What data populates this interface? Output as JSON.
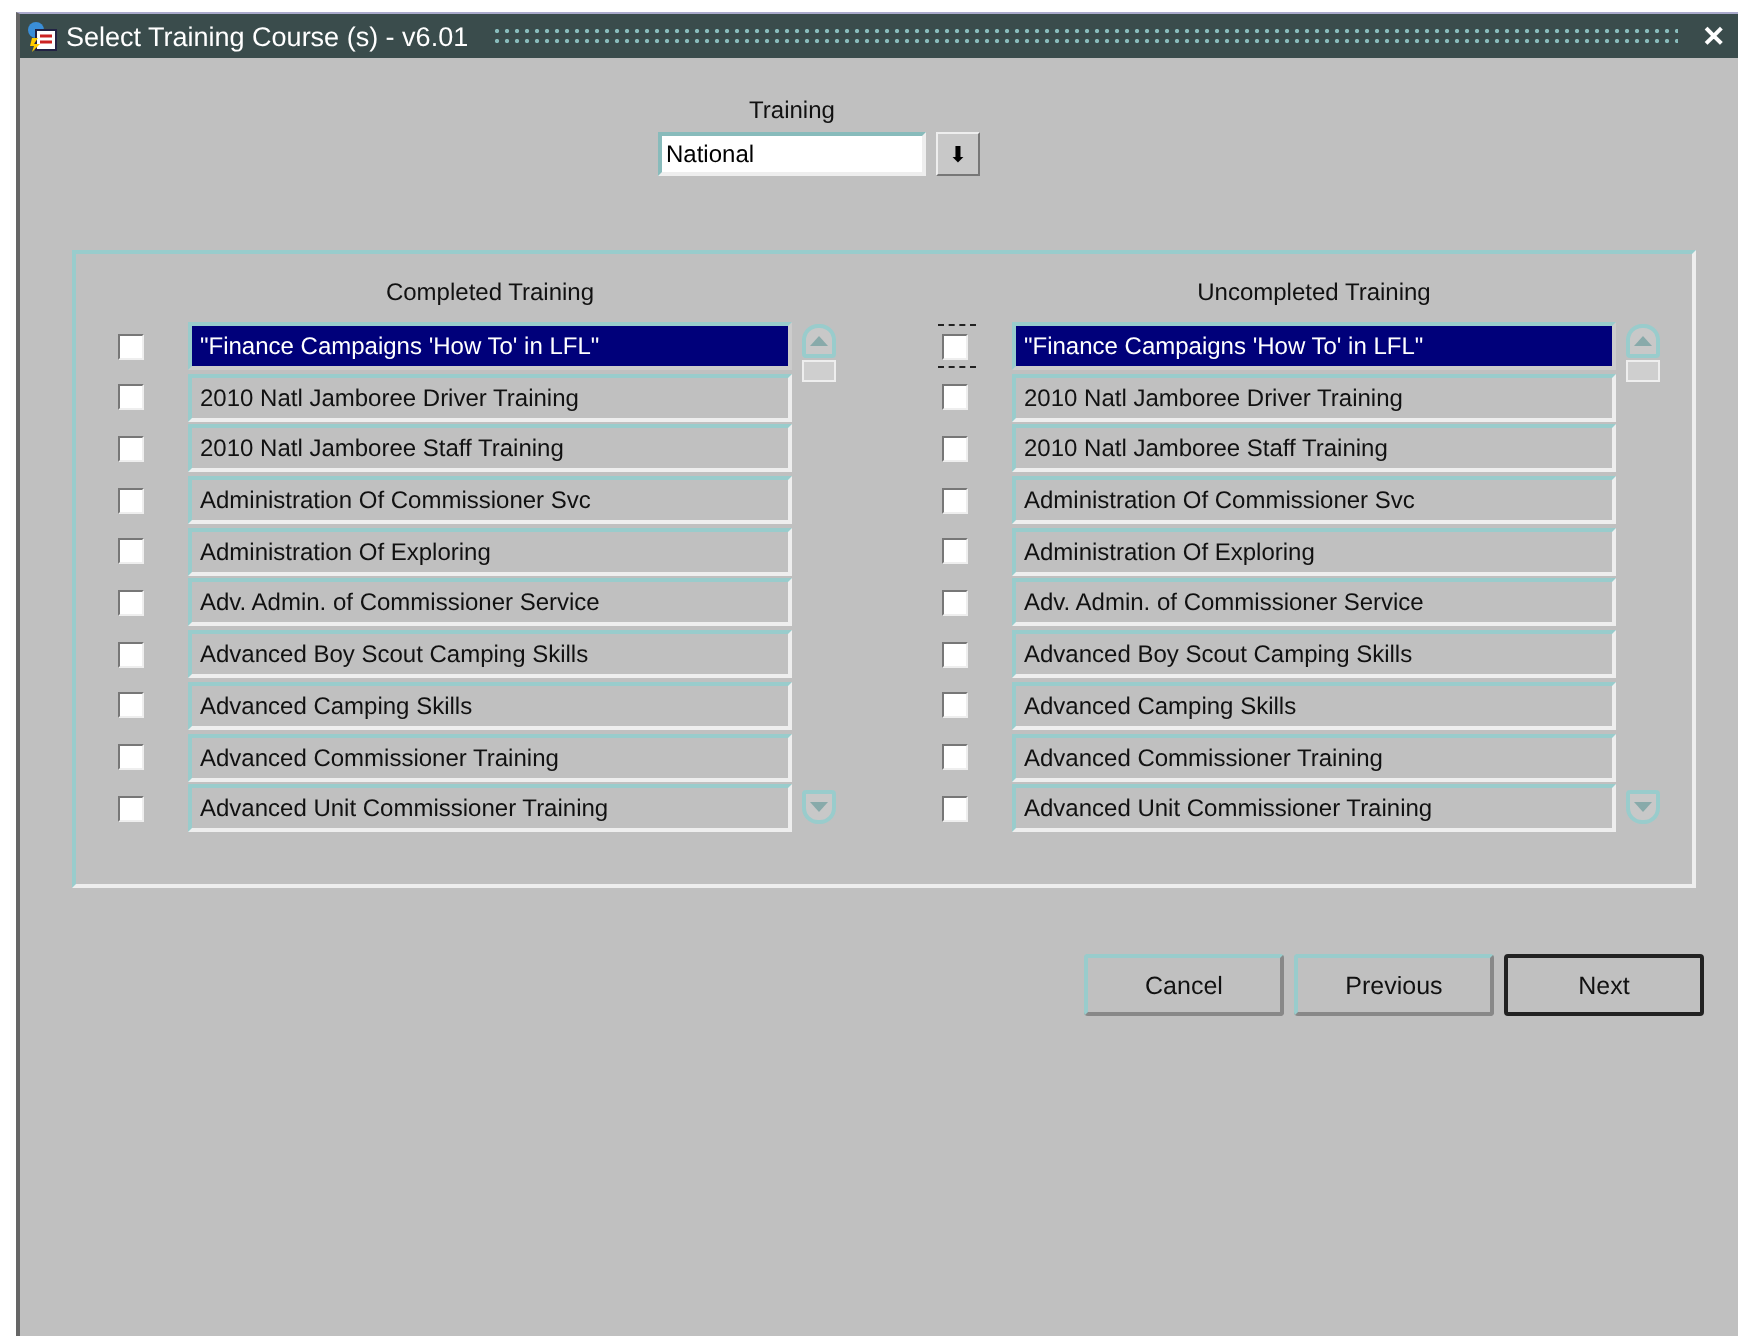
{
  "window": {
    "title": "Select Training Course (s) - v6.01",
    "close": "✕"
  },
  "training": {
    "label": "Training",
    "value": "National",
    "dropdown": "⬇"
  },
  "lists": [
    {
      "heading": "Completed Training",
      "items": [
        {
          "name": "\"Finance Campaigns 'How To' in LFL\"",
          "checked": false,
          "selected": true,
          "focused": false
        },
        {
          "name": "2010 Natl Jamboree Driver Training",
          "checked": false,
          "selected": false,
          "focused": false
        },
        {
          "name": "2010 Natl Jamboree Staff Training",
          "checked": false,
          "selected": false,
          "focused": false
        },
        {
          "name": "Administration Of Commissioner Svc",
          "checked": false,
          "selected": false,
          "focused": false
        },
        {
          "name": "Administration Of Exploring",
          "checked": false,
          "selected": false,
          "focused": false
        },
        {
          "name": "Adv. Admin. of Commissioner Service",
          "checked": false,
          "selected": false,
          "focused": false
        },
        {
          "name": "Advanced Boy Scout Camping Skills",
          "checked": false,
          "selected": false,
          "focused": false
        },
        {
          "name": "Advanced Camping Skills",
          "checked": false,
          "selected": false,
          "focused": false
        },
        {
          "name": "Advanced Commissioner Training",
          "checked": false,
          "selected": false,
          "focused": false
        },
        {
          "name": "Advanced Unit Commissioner Training",
          "checked": false,
          "selected": false,
          "focused": false
        }
      ]
    },
    {
      "heading": "Uncompleted Training",
      "items": [
        {
          "name": "\"Finance Campaigns 'How To' in LFL\"",
          "checked": false,
          "selected": true,
          "focused": true
        },
        {
          "name": "2010 Natl Jamboree Driver Training",
          "checked": false,
          "selected": false,
          "focused": false
        },
        {
          "name": "2010 Natl Jamboree Staff Training",
          "checked": false,
          "selected": false,
          "focused": false
        },
        {
          "name": "Administration Of Commissioner Svc",
          "checked": false,
          "selected": false,
          "focused": false
        },
        {
          "name": "Administration Of Exploring",
          "checked": false,
          "selected": false,
          "focused": false
        },
        {
          "name": "Adv. Admin. of Commissioner Service",
          "checked": false,
          "selected": false,
          "focused": false
        },
        {
          "name": "Advanced Boy Scout Camping Skills",
          "checked": false,
          "selected": false,
          "focused": false
        },
        {
          "name": "Advanced Camping Skills",
          "checked": false,
          "selected": false,
          "focused": false
        },
        {
          "name": "Advanced Commissioner Training",
          "checked": false,
          "selected": false,
          "focused": false
        },
        {
          "name": "Advanced Unit Commissioner Training",
          "checked": false,
          "selected": false,
          "focused": false
        }
      ]
    }
  ],
  "buttons": [
    {
      "label": "Cancel",
      "default": false
    },
    {
      "label": "Previous",
      "default": false
    },
    {
      "label": "Next",
      "default": true
    }
  ]
}
